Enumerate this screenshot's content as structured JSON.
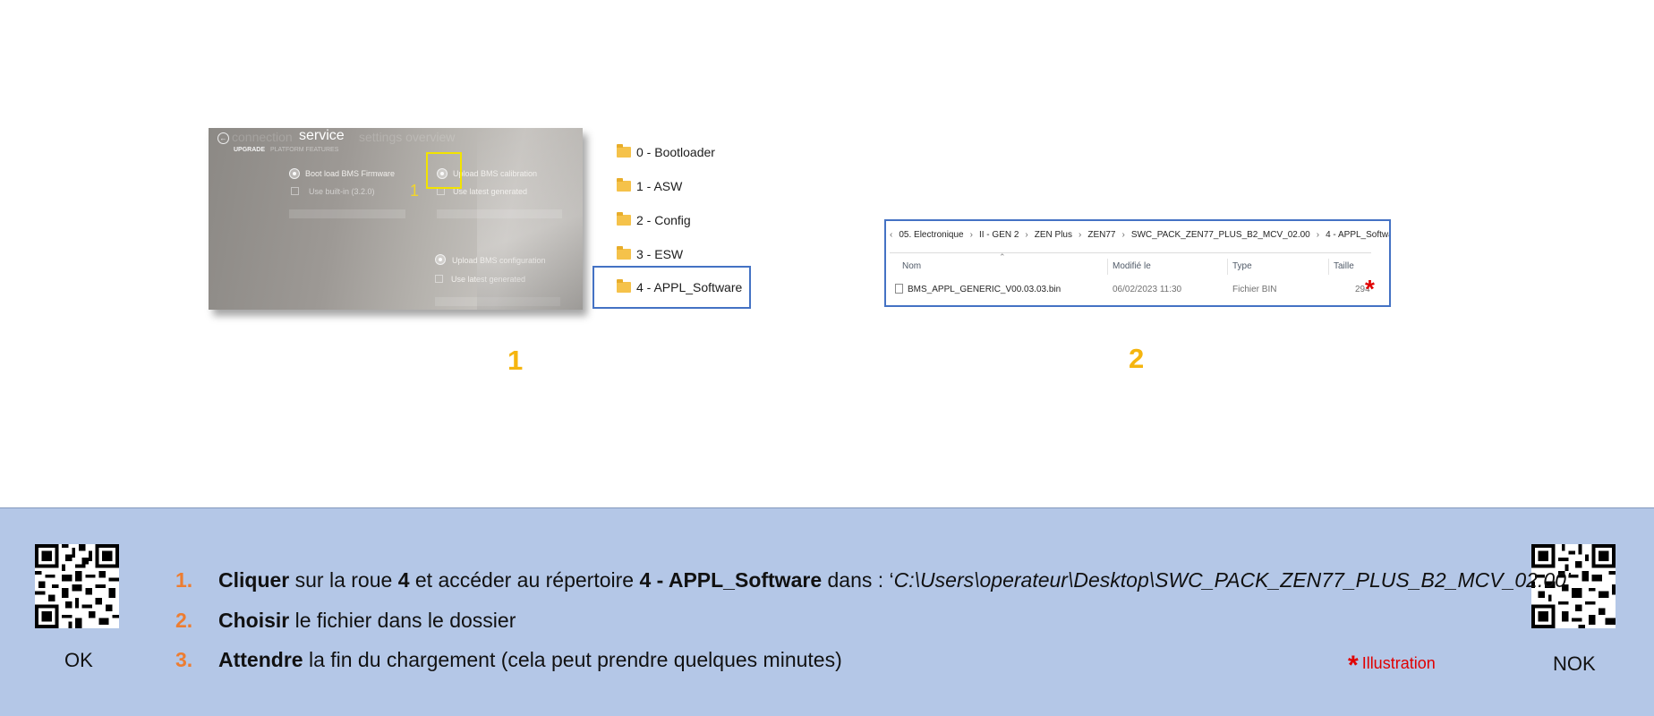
{
  "photo": {
    "nav_title": "service",
    "nav_dim_left": "connection",
    "nav_dim_right": "settings  overview",
    "tab_active": "UPGRADE",
    "tab_other": "PLATFORM FEATURES",
    "opt_bootload": "Boot load BMS Firmware",
    "opt_builtin": "Use built-in (3.2.0)",
    "opt_calibration": "Upload BMS calibration",
    "opt_latest_1": "Use latest generated",
    "opt_configuration": "Upload BMS configuration",
    "opt_latest_2": "Use latest generated",
    "highlight_number": "1"
  },
  "folders": [
    {
      "name": "0 - Bootloader",
      "icon": "folder-icon"
    },
    {
      "name": "1 - ASW",
      "icon": "folder-icon"
    },
    {
      "name": "2 - Config",
      "icon": "folder-icon"
    },
    {
      "name": "3 - ESW",
      "icon": "folder-icon"
    },
    {
      "name": "4 - APPL_Software",
      "icon": "folder-icon",
      "highlighted": true
    }
  ],
  "step_labels": {
    "first": "1",
    "second": "2"
  },
  "explorer": {
    "breadcrumb": [
      "05. Electronique",
      "II - GEN 2",
      "ZEN Plus",
      "ZEN77",
      "SWC_PACK_ZEN77_PLUS_B2_MCV_02.00",
      "4 - APPL_Software"
    ],
    "columns": {
      "name": "Nom",
      "modified": "Modifié le",
      "type": "Type",
      "size": "Taille"
    },
    "file": {
      "name": "BMS_APPL_GENERIC_V00.03.03.bin",
      "modified": "06/02/2023 11:30",
      "type": "Fichier BIN",
      "size": "294"
    }
  },
  "panel": {
    "qr_ok_label": "OK",
    "qr_nok_label": "NOK",
    "steps": [
      {
        "num": "1.",
        "bold1": "Cliquer",
        "t1": " sur la roue ",
        "bold2": "4",
        "t2": " et accéder au répertoire  ",
        "bold3": "4 - APPL_Software",
        "t3": "  dans : ‘",
        "path": "C:\\Users\\operateur\\Desktop\\SWC_PACK_ZEN77_PLUS_B2_MCV_02.00’"
      },
      {
        "num": "2.",
        "bold1": "Choisir",
        "t1": " le fichier dans le dossier"
      },
      {
        "num": "3.",
        "bold1": "Attendre",
        "t1": " la fin du chargement (cela peut prendre quelques minutes)"
      }
    ],
    "illustration_star": "*",
    "illustration_label": "Illustration"
  },
  "colors": {
    "accent_orange": "#ed7d31",
    "step_yellow": "#f5b50f",
    "panel_bg": "#b4c7e7",
    "highlight_blue": "#4472c4",
    "highlight_yellow": "#f2e300",
    "star_red": "#e00000"
  }
}
